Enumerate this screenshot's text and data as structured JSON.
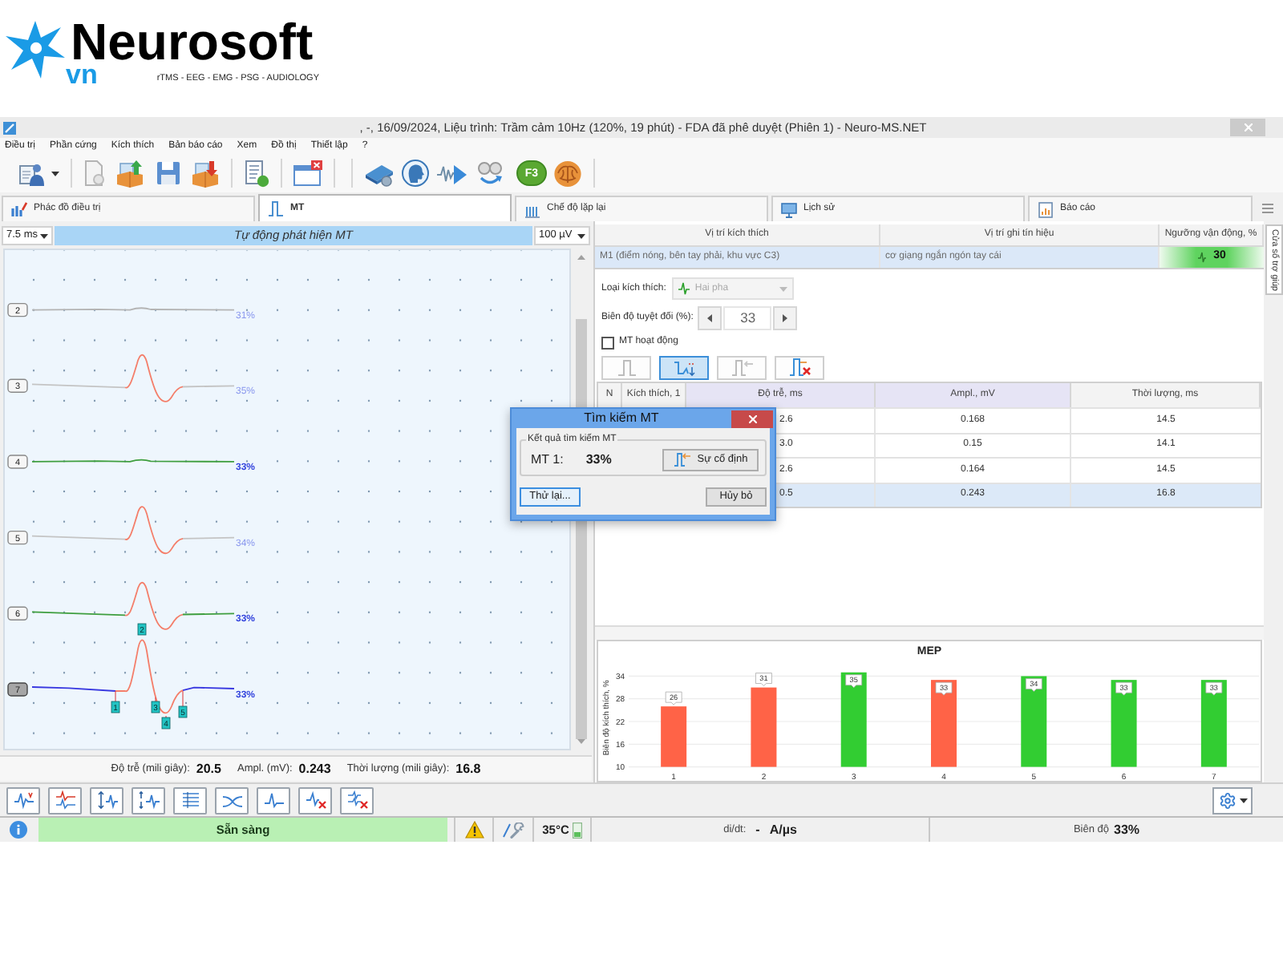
{
  "logo": {
    "name": "Neurosoft",
    "suffix": "vn",
    "tagline": "rTMS - EEG - EMG - PSG - AUDIOLOGY"
  },
  "window": {
    "title": ", -, 16/09/2024, Liệu trình: Trầm cảm 10Hz (120%, 19 phút) - FDA đã phê duyệt (Phiên 1) - Neuro-MS.NET"
  },
  "menu": [
    "Điều trị",
    "Phần cứng",
    "Kích thích",
    "Bản báo cáo",
    "Xem",
    "Đồ thị",
    "Thiết lập",
    "?"
  ],
  "toolbar": {
    "hotkey": "F3"
  },
  "tabs": [
    {
      "label": "Phác đồ điều trị",
      "selected": false
    },
    {
      "label": "MT",
      "selected": true
    },
    {
      "label": "Chế độ lặp lại",
      "selected": false
    },
    {
      "label": "Lịch sử",
      "selected": false
    },
    {
      "label": "Báo cáo",
      "selected": false
    }
  ],
  "trace_panel": {
    "timebase": "7.5 ms",
    "mode": "Tự động phát hiện MT",
    "gain": "100 µV",
    "traces": [
      {
        "label": "2",
        "percent": "31%",
        "kind": "flat",
        "color": "#b4b4b4",
        "emphasized": false,
        "selected": false
      },
      {
        "label": "3",
        "percent": "35%",
        "kind": "mep",
        "color": "#c4c4c4",
        "emphasized": false,
        "selected": false
      },
      {
        "label": "4",
        "percent": "33%",
        "kind": "flat",
        "color": "#3e9e3e",
        "emphasized": true,
        "selected": false
      },
      {
        "label": "5",
        "percent": "34%",
        "kind": "mep",
        "color": "#c4c4c4",
        "emphasized": false,
        "selected": false
      },
      {
        "label": "6",
        "percent": "33%",
        "kind": "mep",
        "color": "#3e9e3e",
        "emphasized": true,
        "selected": false
      },
      {
        "label": "7",
        "percent": "33%",
        "kind": "mep_large",
        "color": "#3838e0",
        "emphasized": true,
        "selected": true
      }
    ],
    "markers": [
      "1",
      "2",
      "3",
      "4",
      "5"
    ],
    "readouts": [
      {
        "label": "Độ trễ (mili giây):",
        "value": "20.5"
      },
      {
        "label": "Ampl. (mV):",
        "value": "0.243"
      },
      {
        "label": "Thời lượng (mili giây):",
        "value": "16.8"
      }
    ]
  },
  "stimulation": {
    "columns": [
      "Vị trí kích thích",
      "Vị trí ghi tín hiệu",
      "Ngưỡng vận động, %"
    ],
    "rows": [
      {
        "site": "M1 (điểm nóng, bên tay phải, khu vực C3)",
        "recording": "cơ giạng ngắn ngón tay cái",
        "threshold": "30",
        "selected": true
      }
    ]
  },
  "side_tab": {
    "label": "Cửa sổ trợ giúp"
  },
  "controls": {
    "stimulus_type": {
      "label": "Loại kích thích:",
      "value": "Hai pha",
      "disabled": true
    },
    "amplitude": {
      "label": "Biên độ tuyệt đối (%):",
      "value": "33"
    },
    "active_mt": {
      "label": "MT hoạt động",
      "checked": false
    },
    "tools": [
      {
        "kind": "pulse",
        "selected": false,
        "disabled": true
      },
      {
        "kind": "auto",
        "selected": true,
        "disabled": false
      },
      {
        "kind": "pulse_arrow",
        "selected": false,
        "disabled": true
      },
      {
        "kind": "pulse_remove",
        "selected": false,
        "disabled": false
      }
    ]
  },
  "results": {
    "columns": [
      {
        "label": "N",
        "highlighted": false
      },
      {
        "label": "Kích thích, 1",
        "highlighted": false
      },
      {
        "label": "Độ trễ, ms",
        "highlighted": true
      },
      {
        "label": "Ampl., mV",
        "highlighted": true
      },
      {
        "label": "Thời lượng, ms",
        "highlighted": false
      }
    ],
    "rows": [
      {
        "latency": "2.6",
        "amplitude": "0.168",
        "duration": "14.5",
        "selected": false
      },
      {
        "latency": "3.0",
        "amplitude": "0.15",
        "duration": "14.1",
        "selected": false
      },
      {
        "latency": "2.6",
        "amplitude": "0.164",
        "duration": "14.5",
        "selected": false
      },
      {
        "latency": "0.5",
        "amplitude": "0.243",
        "duration": "16.8",
        "selected": true
      }
    ]
  },
  "dialog": {
    "title": "Tìm kiếm MT",
    "group": "Kết quả tìm kiếm MT",
    "result_label": "MT 1:",
    "result_value": "33%",
    "fix_button": "Sự cố định",
    "buttons": [
      {
        "label": "Thử lại...",
        "focused": true
      },
      {
        "label": "Hủy bỏ",
        "focused": false
      }
    ]
  },
  "mep_chart": {
    "chart_data": {
      "type": "bar",
      "title": "MEP",
      "ylabel": "Biên độ kích thích, %",
      "categories": [
        "1",
        "2",
        "3",
        "4",
        "5",
        "6",
        "7"
      ],
      "values": [
        26,
        31,
        35,
        33,
        34,
        33,
        33
      ],
      "ylim": [
        10,
        36
      ],
      "yticks": [
        10,
        16,
        22,
        28,
        34
      ],
      "grid": true,
      "data_labels": true
    },
    "bars": [
      {
        "color": "#ff6347"
      },
      {
        "color": "#ff6347"
      },
      {
        "color": "#32cd32"
      },
      {
        "color": "#ff6347"
      },
      {
        "color": "#32cd32"
      },
      {
        "color": "#32cd32"
      },
      {
        "color": "#32cd32"
      }
    ]
  },
  "status_bar": {
    "status": "Sẵn sàng",
    "temperature": "35°C",
    "didt_label": "di/dt:",
    "didt_value": "-",
    "didt_unit": "A/µs",
    "amplitude_label": "Biên độ",
    "amplitude_value": "33%"
  }
}
